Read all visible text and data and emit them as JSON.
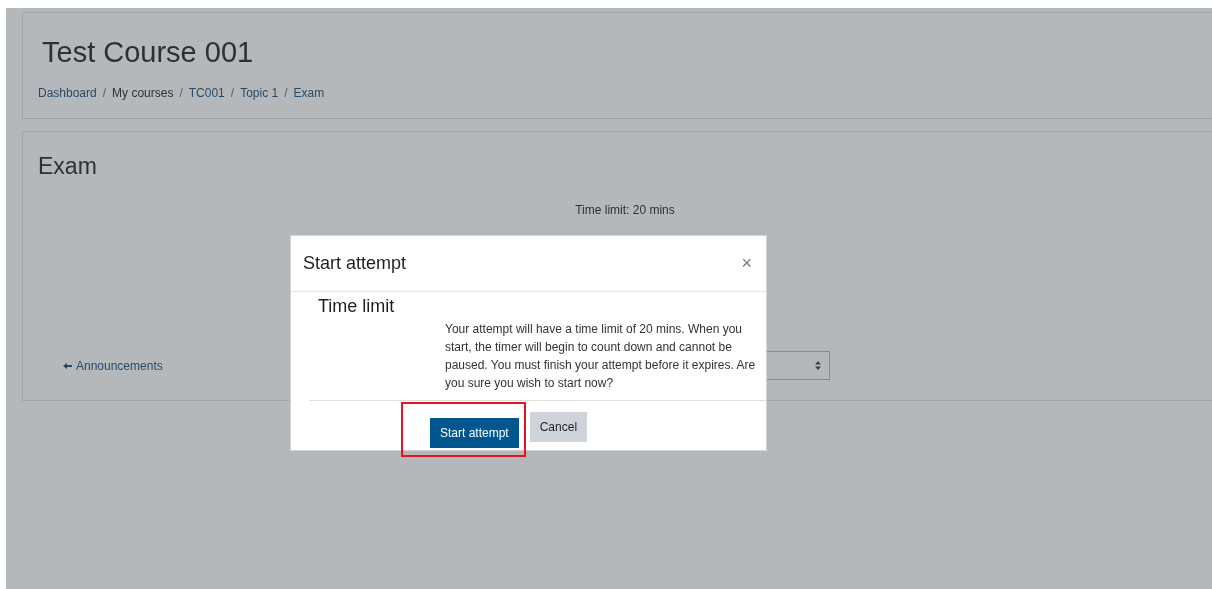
{
  "page_title": "Test Course 001",
  "breadcrumb": {
    "separator": "/",
    "items": [
      {
        "label": "Dashboard",
        "link": true
      },
      {
        "label": "My courses",
        "link": false
      },
      {
        "label": "TC001",
        "link": true
      },
      {
        "label": "Topic 1",
        "link": true
      },
      {
        "label": "Exam",
        "link": true
      }
    ]
  },
  "activity": {
    "title": "Exam",
    "info": [
      "Time limit: 20 mins"
    ],
    "navigation_link": "Announcements"
  },
  "dialog": {
    "title": "Start attempt",
    "close": "×",
    "heading": "Time limit",
    "message": "Your attempt will have a time limit of 20 mins. When you start, the timer will begin to count down and cannot be paused. You must finish your attempt before it expires. Are you sure you wish to start now?",
    "buttons": [
      {
        "label": "Start attempt",
        "kind": "primary",
        "highlighted": true
      },
      {
        "label": "Cancel",
        "kind": "secondary",
        "highlighted": false
      }
    ]
  }
}
